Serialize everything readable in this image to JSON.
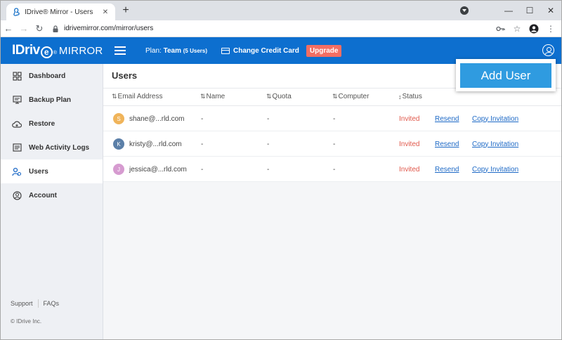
{
  "browser": {
    "tab_title": "IDrive® Mirror - Users",
    "tab_close": "✕",
    "new_tab": "+",
    "url": "idrivemirror.com/mirror/users",
    "minimize": "—",
    "maximize": "☐",
    "close": "✕"
  },
  "header": {
    "logo_text": "IDriv",
    "logo_e": "e",
    "logo_reg": "®",
    "logo_product": "MIRROR",
    "plan_label": "Plan: ",
    "plan_name": "Team",
    "plan_users": "(5 Users)",
    "change_card": "Change Credit Card",
    "upgrade": "Upgrade"
  },
  "sidebar": {
    "items": [
      {
        "label": "Dashboard",
        "icon": "dashboard-icon"
      },
      {
        "label": "Backup Plan",
        "icon": "backup-plan-icon"
      },
      {
        "label": "Restore",
        "icon": "restore-cloud-icon"
      },
      {
        "label": "Web Activity Logs",
        "icon": "logs-icon"
      },
      {
        "label": "Users",
        "icon": "users-icon",
        "active": true
      },
      {
        "label": "Account",
        "icon": "account-icon"
      }
    ],
    "support": "Support",
    "faqs": "FAQs",
    "copyright": "© IDrive Inc."
  },
  "main": {
    "title": "Users",
    "add_user": "Add User",
    "columns": [
      "Email Address",
      "Name",
      "Quota",
      "Computer",
      "Status"
    ],
    "rows": [
      {
        "initial": "S",
        "email": "shane@...rld.com",
        "name": "-",
        "quota": "-",
        "computer": "-",
        "status": "Invited",
        "resend": "Resend",
        "copy": "Copy Invitation"
      },
      {
        "initial": "K",
        "email": "kristy@...rld.com",
        "name": "-",
        "quota": "-",
        "computer": "-",
        "status": "Invited",
        "resend": "Resend",
        "copy": "Copy Invitation"
      },
      {
        "initial": "J",
        "email": "jessica@...rld.com",
        "name": "-",
        "quota": "-",
        "computer": "-",
        "status": "Invited",
        "resend": "Resend",
        "copy": "Copy Invitation"
      }
    ]
  },
  "colors": {
    "brand": "#0d6fcf",
    "upgrade": "#f36e63",
    "add_user": "#2f9be0",
    "status_invited": "#e0584b",
    "link": "#1d69c6",
    "avatar_s": "#f0b45a",
    "avatar_k": "#5b7fa8",
    "avatar_j": "#d69bd0"
  }
}
